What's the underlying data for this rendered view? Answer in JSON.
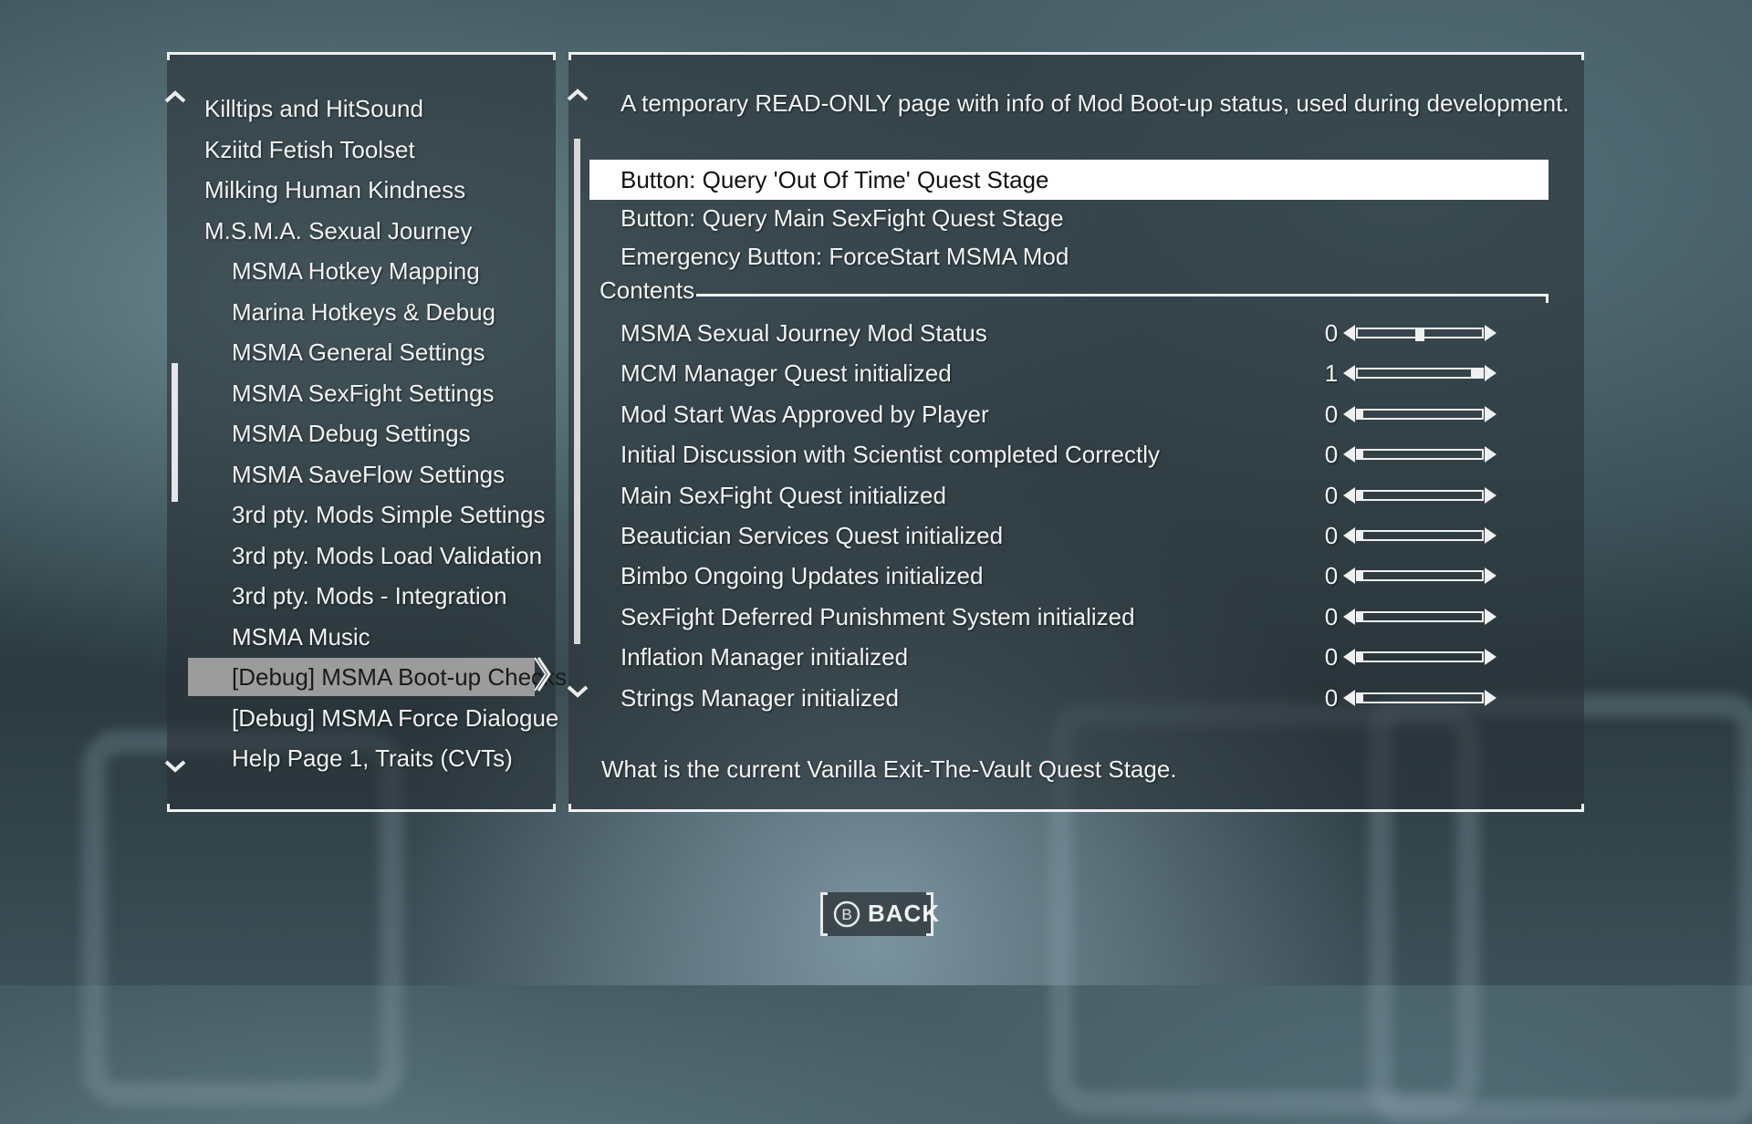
{
  "left_menu": {
    "items": [
      {
        "label": "Killtips and HitSound"
      },
      {
        "label": "Kziitd Fetish Toolset"
      },
      {
        "label": "Milking Human Kindness"
      },
      {
        "label": "M.S.M.A. Sexual Journey"
      },
      {
        "label": "MSMA Hotkey Mapping"
      },
      {
        "label": "Marina Hotkeys & Debug"
      },
      {
        "label": "MSMA General Settings"
      },
      {
        "label": "MSMA SexFight Settings"
      },
      {
        "label": "MSMA Debug Settings"
      },
      {
        "label": "MSMA SaveFlow Settings"
      },
      {
        "label": "3rd pty. Mods Simple Settings"
      },
      {
        "label": "3rd pty. Mods Load Validation"
      },
      {
        "label": "3rd pty. Mods - Integration"
      },
      {
        "label": "MSMA Music"
      },
      {
        "label": "[Debug] MSMA Boot-up Checks"
      },
      {
        "label": "[Debug] MSMA Force Dialogue"
      },
      {
        "label": "Help Page 1, Traits (CVTs)"
      }
    ],
    "selected_index": 14
  },
  "content": {
    "description": "A temporary READ-ONLY page with info of Mod Boot-up status, used during development.",
    "options": [
      {
        "label": "Button: Query 'Out Of Time' Quest Stage"
      },
      {
        "label": "Button: Query Main SexFight Quest Stage"
      },
      {
        "label": "Emergency Button: ForceStart MSMA Mod"
      }
    ],
    "selected_option": 0,
    "section_header": "Contents",
    "rows": [
      {
        "label": "MSMA Sexual Journey Mod Status",
        "value": "0",
        "level": 0.5
      },
      {
        "label": "MCM Manager Quest initialized",
        "value": "1",
        "level": 1.0
      },
      {
        "label": "Mod Start Was Approved by Player",
        "value": "0",
        "level": 0
      },
      {
        "label": "Initial Discussion with Scientist completed Correctly",
        "value": "0",
        "level": 0
      },
      {
        "label": "Main SexFight Quest initialized",
        "value": "0",
        "level": 0
      },
      {
        "label": "Beautician Services Quest initialized",
        "value": "0",
        "level": 0
      },
      {
        "label": "Bimbo Ongoing Updates initialized",
        "value": "0",
        "level": 0
      },
      {
        "label": "SexFight Deferred Punishment System initialized",
        "value": "0",
        "level": 0
      },
      {
        "label": "Inflation Manager initialized",
        "value": "0",
        "level": 0
      },
      {
        "label": "Strings Manager initialized",
        "value": "0",
        "level": 0
      }
    ],
    "footer_info": "What is the current  Vanilla Exit-The-Vault Quest Stage."
  },
  "back_button": {
    "label": "BACK",
    "key_glyph": "B"
  },
  "colors": {
    "accent": "#f0f0f0",
    "selection_bg": "#9c9c9c",
    "option_selected_bg": "#ffffff"
  },
  "icons": [
    "chevron-up-icon",
    "chevron-down-icon",
    "chevron-right-icon",
    "b-button-icon"
  ]
}
